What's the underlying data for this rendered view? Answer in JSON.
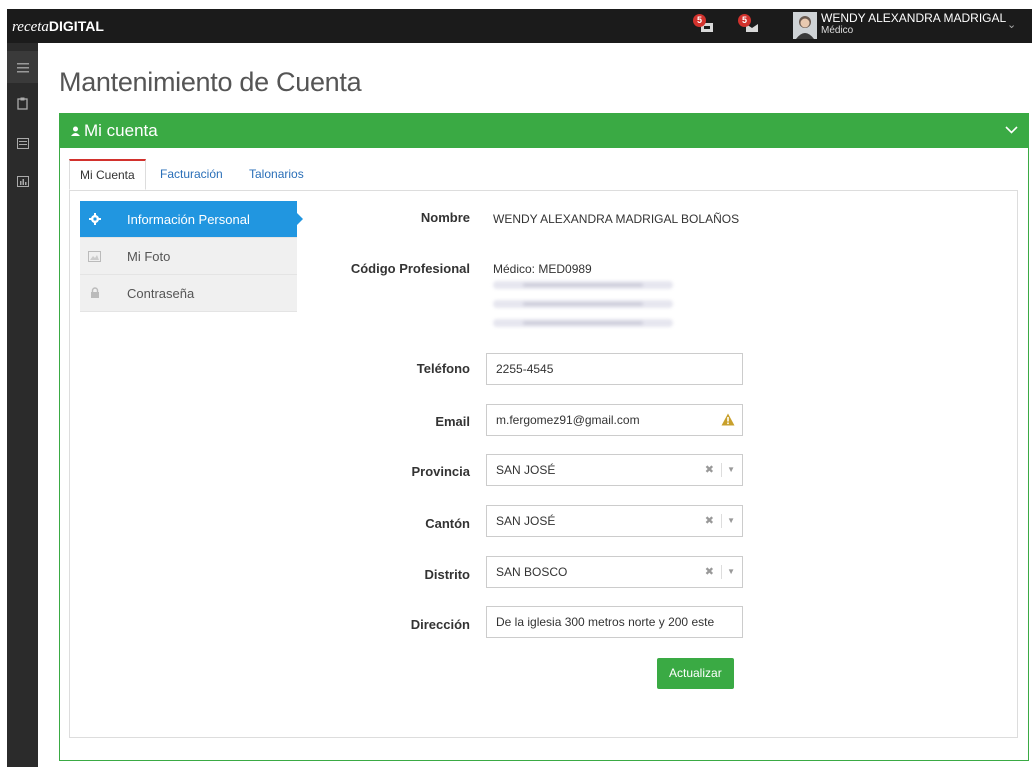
{
  "app": {
    "brand_italic": "receta",
    "brand_bold": "DIGITAL"
  },
  "header": {
    "notifications": [
      {
        "badge": "5",
        "icon": "inbox-icon"
      },
      {
        "badge": "5",
        "icon": "mail-icon"
      }
    ],
    "user": {
      "name": "WENDY ALEXANDRA MADRIGAL",
      "role": "Médico"
    }
  },
  "sidebar": {
    "items": [
      "menu-icon",
      "clipboard-icon",
      "list-icon",
      "chart-icon"
    ]
  },
  "page": {
    "title": "Mantenimiento de Cuenta"
  },
  "panel": {
    "title": "Mi cuenta"
  },
  "tabs": [
    {
      "label": "Mi Cuenta",
      "active": true
    },
    {
      "label": "Facturación",
      "active": false
    },
    {
      "label": "Talonarios",
      "active": false
    }
  ],
  "side_menu": [
    {
      "label": "Información Personal",
      "icon": "gear-icon",
      "active": true
    },
    {
      "label": "Mi Foto",
      "icon": "image-icon",
      "active": false
    },
    {
      "label": "Contraseña",
      "icon": "lock-icon",
      "active": false
    }
  ],
  "form": {
    "nombre_label": "Nombre",
    "nombre_value": "WENDY ALEXANDRA MADRIGAL BOLAÑOS",
    "codigo_label": "Código Profesional",
    "codigo_value": "Médico: MED0989",
    "telefono_label": "Teléfono",
    "telefono_value": "2255-4545",
    "email_label": "Email",
    "email_value": "m.fergomez91@gmail.com",
    "provincia_label": "Provincia",
    "provincia_value": "SAN JOSÉ",
    "canton_label": "Cantón",
    "canton_value": "SAN JOSÉ",
    "distrito_label": "Distrito",
    "distrito_value": "SAN BOSCO",
    "direccion_label": "Dirección",
    "direccion_value": "De la iglesia 300 metros norte y 200 este",
    "submit_label": "Actualizar"
  },
  "colors": {
    "topbar": "#1b1b1b",
    "sidebar": "#2b2b2b",
    "primary_green": "#3aaa44",
    "active_blue": "#2196e0",
    "badge_red": "#d2322d",
    "warning": "#c8a02c"
  }
}
